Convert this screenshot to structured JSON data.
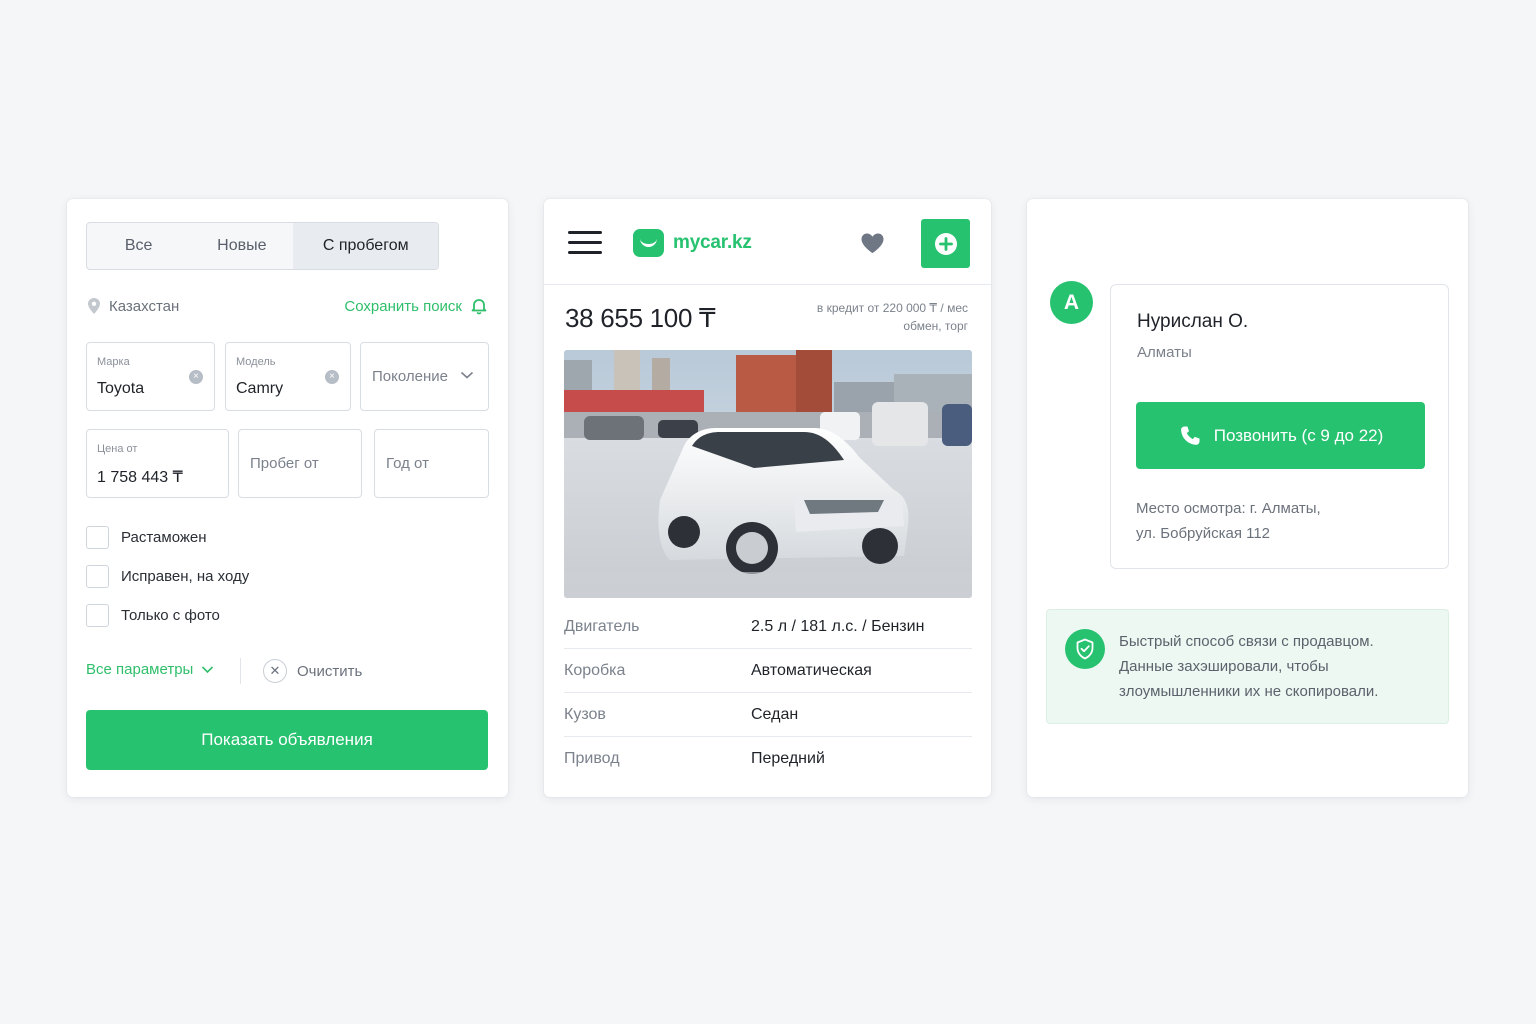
{
  "filters": {
    "tabs": [
      {
        "label": "Все",
        "active": false
      },
      {
        "label": "Новые",
        "active": false
      },
      {
        "label": "С пробегом",
        "active": true
      }
    ],
    "location": "Казахстан",
    "save_search": "Сохранить поиск",
    "brand": {
      "label": "Марка",
      "value": "Toyota"
    },
    "model": {
      "label": "Модель",
      "value": "Camry"
    },
    "generation": {
      "placeholder": "Поколение"
    },
    "price_from": {
      "label": "Цена от",
      "value": "1 758 443 ₸"
    },
    "mileage_from": {
      "placeholder": "Пробег от"
    },
    "year_from": {
      "placeholder": "Год от"
    },
    "checkboxes": [
      {
        "label": "Растаможен",
        "checked": false
      },
      {
        "label": "Исправен, на ходу",
        "checked": false
      },
      {
        "label": "Только с фото",
        "checked": false
      }
    ],
    "all_params": "Все параметры",
    "clear": "Очистить",
    "submit": "Показать объявления"
  },
  "listing": {
    "logo": "mycar.kz",
    "price": "38 655 100 ₸",
    "credit_line1": "в кредит от 220 000 ₸ / мес",
    "credit_line2": "обмен, торг",
    "specs": [
      {
        "key": "Двигатель",
        "value": "2.5 л / 181 л.с. / Бензин"
      },
      {
        "key": "Коробка",
        "value": "Автоматическая"
      },
      {
        "key": "Кузов",
        "value": "Седан"
      },
      {
        "key": "Привод",
        "value": "Передний"
      }
    ]
  },
  "seller": {
    "avatar_letter": "A",
    "name": "Нурислан О.",
    "city": "Алматы",
    "call": "Позвонить (с 9 до 22)",
    "inspect_line1": "Место осмотра: г. Алматы,",
    "inspect_line2": "ул. Бобруйская 112",
    "secure_line1": "Быстрый способ связи с продавцом.",
    "secure_line2": "Данные захэшировали, чтобы",
    "secure_line3": "злоумышленники их не скопировали."
  },
  "colors": {
    "accent": "#27c270",
    "background": "#f4f6f8",
    "muted": "#7b828c"
  }
}
